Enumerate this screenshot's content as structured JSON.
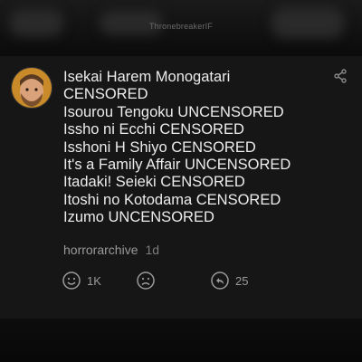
{
  "header": {
    "watermark": "ThronebreakerIF"
  },
  "comment": {
    "lines": [
      "Isekai Harem Monogatari",
      "CENSORED",
      "Isourou Tengoku UNCENSORED",
      "Issho ni Ecchi CENSORED",
      "Isshoni H Shiyo CENSORED",
      "It's a Family Affair UNCENSORED",
      "Itadaki! Seieki CENSORED",
      "Itoshi no Kotodama CENSORED",
      "Izumo UNCENSORED"
    ],
    "author": "horrorarchive",
    "time": "1d"
  },
  "actions": {
    "like_count": "1K",
    "dislike_count": "",
    "reply_count": "25"
  },
  "icons": {
    "share": "share-icon",
    "like": "smile-icon",
    "dislike": "frown-icon",
    "reply": "reply-icon"
  },
  "colors": {
    "background": "#0b0b0b",
    "card": "#161616",
    "text": "#ececec",
    "muted": "#9a9a9a"
  }
}
